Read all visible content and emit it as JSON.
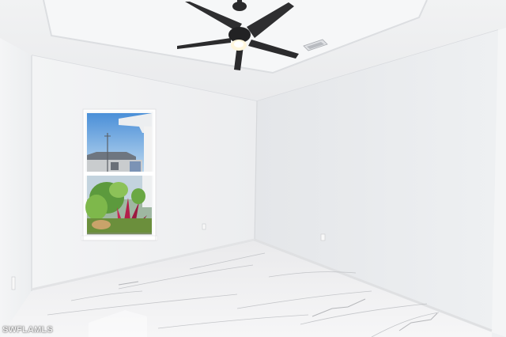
{
  "photo": {
    "watermark": "SWFLAMLS"
  }
}
